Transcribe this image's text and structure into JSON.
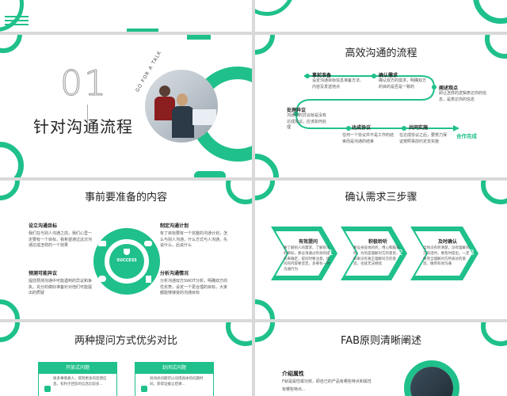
{
  "slide2": {
    "number": "01",
    "title": "针对沟通流程",
    "photo_caption": "GO FOR A TALK"
  },
  "slide3": {
    "title": "高效沟通的流程",
    "steps": [
      {
        "num": "1",
        "label": "事前准备",
        "desc": "设定沟通目标信息准备方法、内容及发送地点"
      },
      {
        "num": "2",
        "label": "确认需求",
        "desc": "确认双方的需求，明确双方的目的是否是一致的"
      },
      {
        "num": "3",
        "label": "阐述观点",
        "desc": "即让怎样的逻辑表达你的信息，是表达你的信息"
      },
      {
        "num": "4",
        "label": "处理异议",
        "desc": "沟通中的异议就是没有达成协议，应该如何处理"
      },
      {
        "num": "5",
        "label": "达成协议",
        "desc": "任何一个协议并不是工作的结束而是沟通的结束"
      },
      {
        "num": "6",
        "label": "共同实施",
        "desc": "在达成协议之后，要努力保证按照事前约定去实施"
      }
    ],
    "end_label": "合作完成"
  },
  "slide4": {
    "title": "事前要准备的内容",
    "center": "SUCCESS",
    "items": [
      {
        "title": "设立沟通目标",
        "desc": "我们在与别人沟通之前，我们心里一定要有一个目标，我希望通过这次沟通达成怎样的一个效果"
      },
      {
        "title": "制定沟通计划",
        "desc": "有了目标要有一个完整的沟通计划，怎么与别人沟通，什么方式与人沟通，先说什么，后说什么"
      },
      {
        "title": "预测可能异议",
        "desc": "提前预测沟通中可能遇到的异议和争执，充分的做好准备针对他们可能提出的质疑"
      },
      {
        "title": "分析沟通情况",
        "desc": "分析沟通双方SWOT分析，明确双方的优劣势，设定一个更合理的目标，大家都能够接受的沟通目标"
      }
    ]
  },
  "slide5": {
    "title": "确认需求三步骤",
    "steps": [
      {
        "num": "01",
        "title": "有效提问",
        "desc": "要了解别人的需求、了解别人的目标，那必须通过有效的提问来确定，提问时要注意，提问的内容要坚定，多要有一种沟通行为"
      },
      {
        "num": "02",
        "title": "积极聆听",
        "desc": "要设身处地的听，用心和脑去听，为的是理解对方的意思，如果没有真正理解对方的意思，也就无法继续"
      },
      {
        "num": "03",
        "title": "及时确认",
        "desc": "当你没有听清楚，没有理解对方的话时，要及时提出，一定要完全理解对方所表达的意思，做到有效沟通"
      }
    ]
  },
  "slide6": {
    "title": "两种提问方式优劣对比",
    "open_label": "开放式问题",
    "closed_label": "封闭式问题",
    "open_desc": "很多事情真人，得到更多的反馈信息，有利于回答的信息比较多...",
    "closed_desc": "封闭式问题可以问得具体的问题时间，获得证据让结果..."
  },
  "slide7": {
    "title": "FAB原则清晰阐述",
    "attr_title": "介绍属性",
    "attr_desc": "F就是属性或功效，即自己的产品有哪些特点和属性",
    "attr_desc2": "有哪些特点..."
  }
}
